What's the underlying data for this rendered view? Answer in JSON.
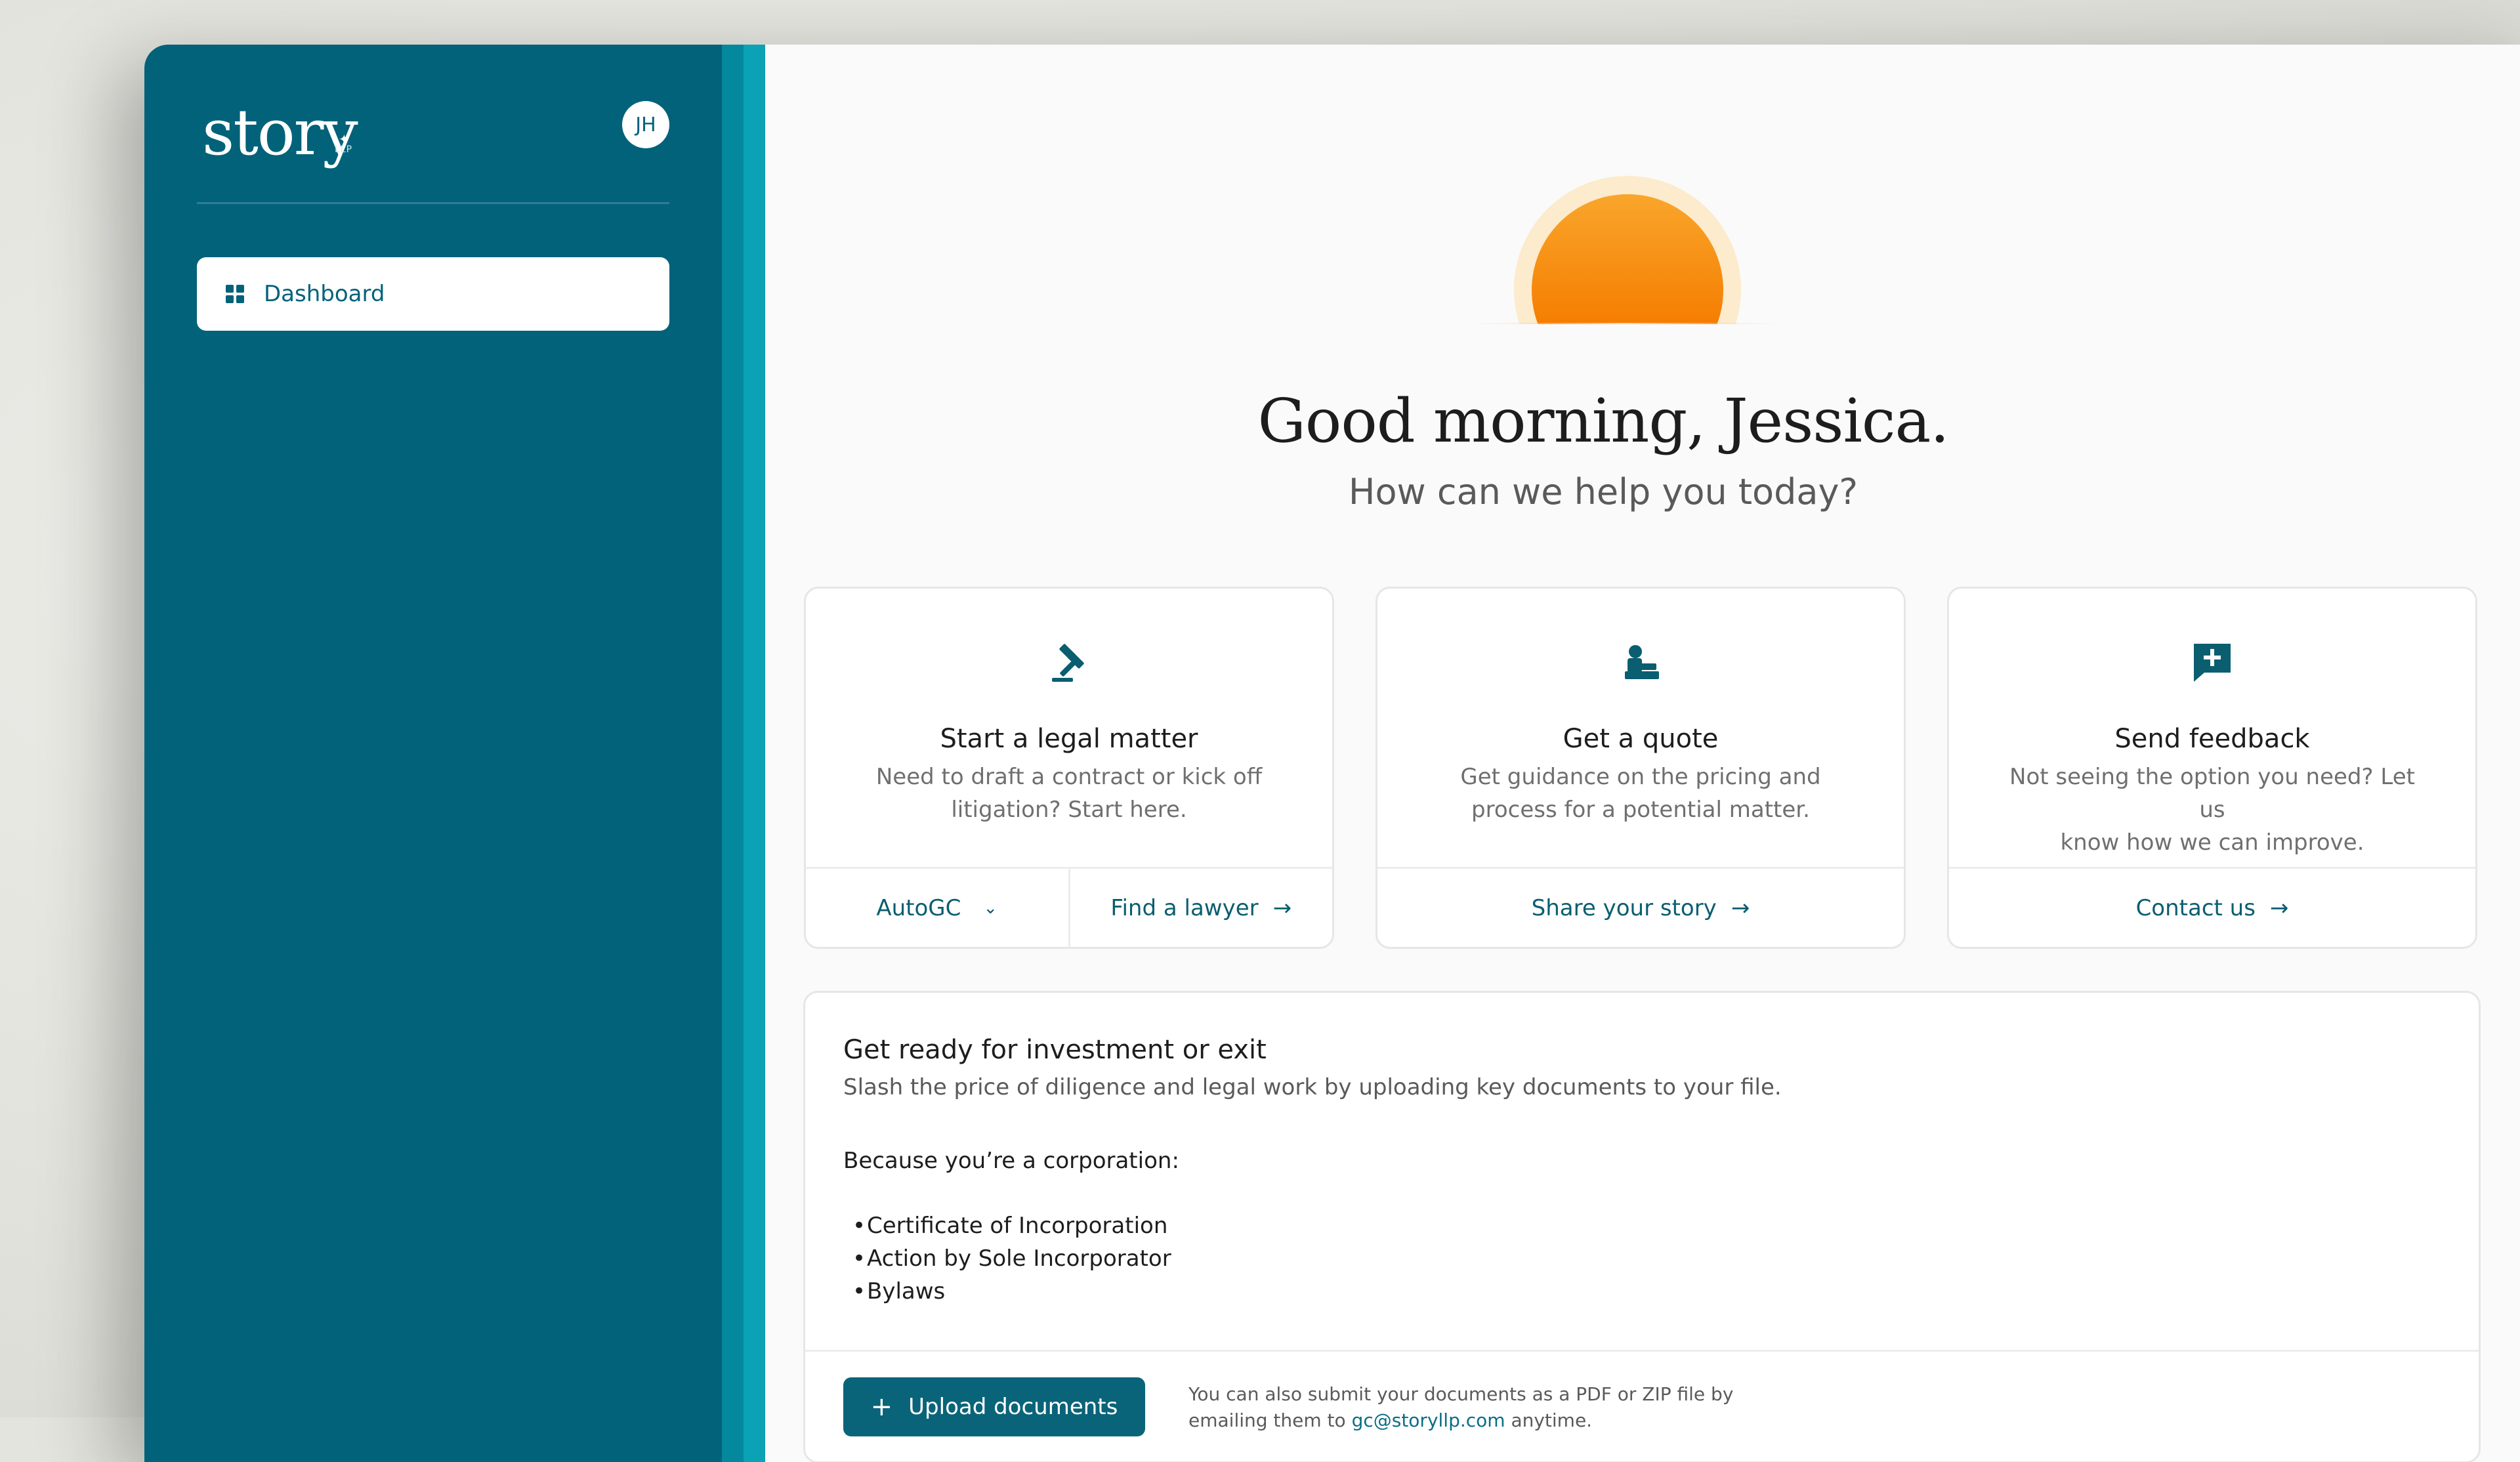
{
  "sidebar": {
    "logo_text": "story",
    "logo_sub": "LLP",
    "avatar_initials": "JH",
    "items": [
      {
        "label": "Dashboard"
      }
    ]
  },
  "hero": {
    "greeting": "Good morning, Jessica.",
    "subtitle": "How can we help you today?"
  },
  "cards": [
    {
      "icon": "gavel-icon",
      "title": "Start a legal matter",
      "desc_line1": "Need to draft a contract or kick off",
      "desc_line2": "litigation? Start here.",
      "actions": [
        {
          "label": "AutoGC"
        },
        {
          "label": "Find a lawyer"
        }
      ]
    },
    {
      "icon": "person-desk-icon",
      "title": "Get a quote",
      "desc_line1": "Get guidance on the pricing and",
      "desc_line2": "process for a potential matter.",
      "actions": [
        {
          "label": "Share your story"
        }
      ]
    },
    {
      "icon": "feedback-icon",
      "title": "Send feedback",
      "desc_line1": "Not seeing the option you need? Let us",
      "desc_line2": "know how we can improve.",
      "actions": [
        {
          "label": "Contact us"
        }
      ]
    }
  ],
  "invest": {
    "title": "Get ready for investment or exit",
    "desc": "Slash the price of diligence and legal work by uploading key documents to your file.",
    "because": "Because you’re a corporation:",
    "documents": [
      "Certificate of Incorporation",
      "Action by Sole Incorporator",
      "Bylaws"
    ],
    "upload_label": "Upload documents",
    "note_line1": "You can also submit your documents as a PDF or ZIP file by",
    "note_pre": "emailing them to ",
    "note_email": "gc@storyllp.com",
    "note_post": " anytime."
  },
  "colors": {
    "brand": "#02627a",
    "accent_sun": "#f57c00",
    "link": "#0a5e70"
  }
}
